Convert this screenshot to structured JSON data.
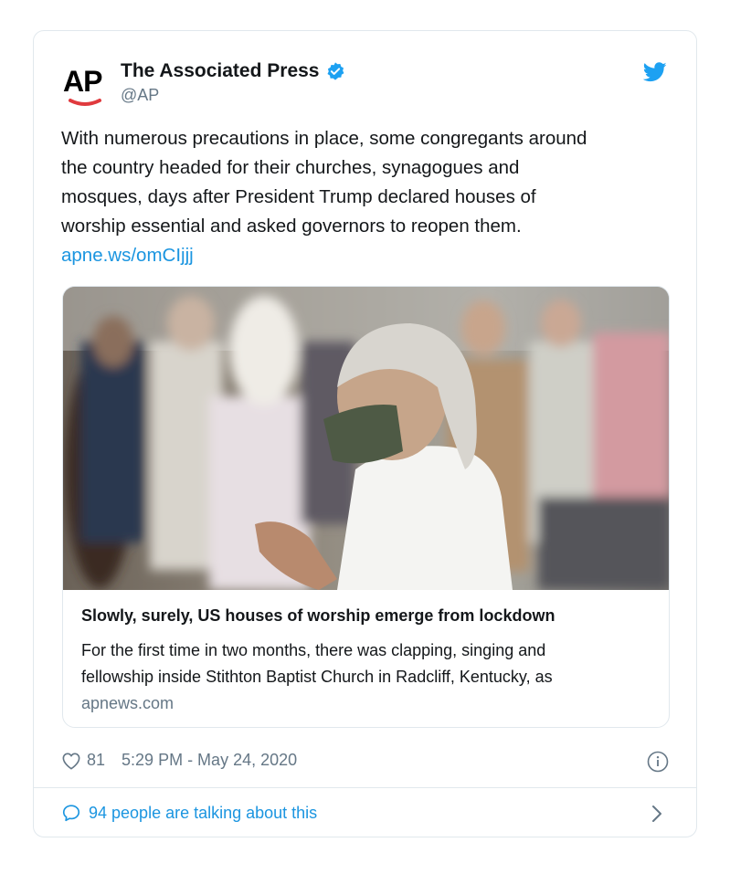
{
  "account": {
    "name": "The Associated Press",
    "handle": "@AP",
    "logo_text": "AP",
    "verified": true
  },
  "tweet": {
    "text": "With numerous precautions in place, some congregants around\nthe country headed for their churches, synagogues and\nmosques, days after President Trump declared houses of\nworship essential and asked governors to reopen them.",
    "link": "apne.ws/omCIjjj"
  },
  "card": {
    "title": "Slowly, surely, US houses of worship emerge from lockdown",
    "description": "For the first time in two months, there was clapping, singing and\nfellowship inside Stithton Baptist Church in Radcliff, Kentucky, as",
    "domain": "apnews.com"
  },
  "meta": {
    "likes": "81",
    "timestamp": "5:29 PM - May 24, 2020"
  },
  "footer": {
    "talking": "94 people are talking about this"
  },
  "colors": {
    "link_blue": "#1b95e0",
    "verified_blue": "#1da1f2",
    "ap_red": "#e03a3e",
    "text": "#14171a",
    "secondary": "#657786",
    "border": "#e1e8ed"
  },
  "icons": [
    "ap-logo",
    "verified-badge-icon",
    "twitter-bird-icon",
    "heart-icon",
    "info-icon",
    "speech-bubble-icon",
    "chevron-right-icon"
  ]
}
